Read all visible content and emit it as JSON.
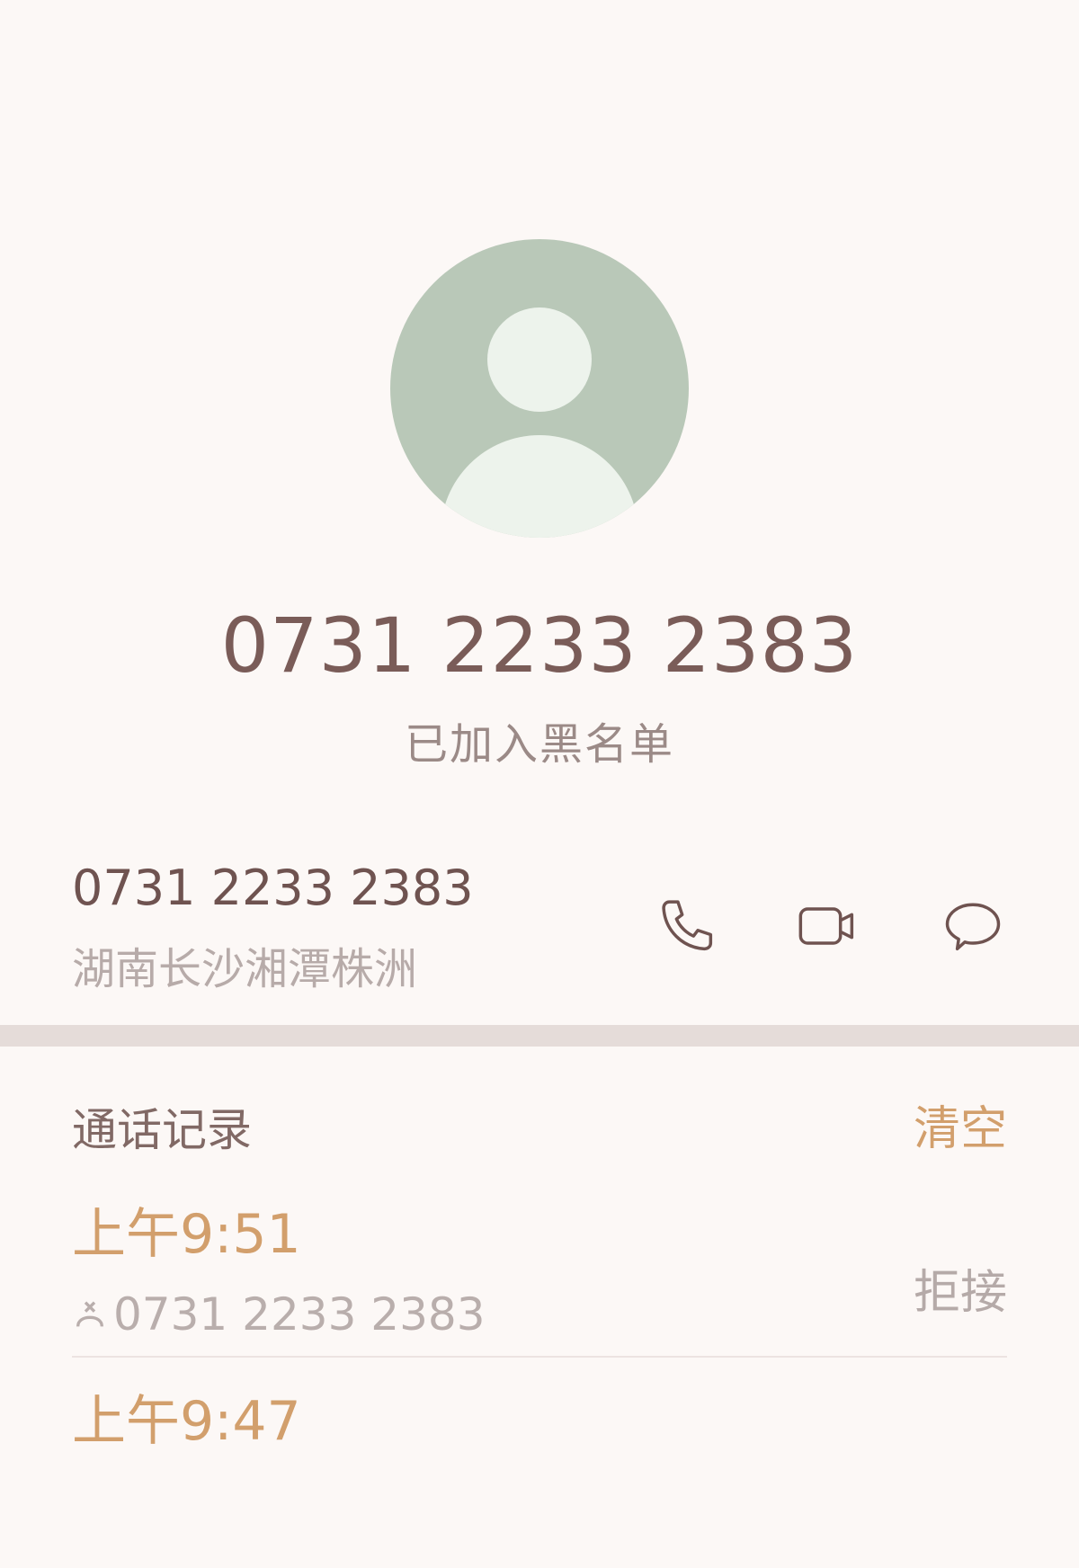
{
  "contact": {
    "number": "0731 2233 2383",
    "status": "已加入黑名单",
    "location": "湖南长沙湘潭株洲"
  },
  "actions": {
    "call_icon": "phone-icon",
    "video_icon": "video-camera-icon",
    "message_icon": "message-bubble-icon"
  },
  "call_log": {
    "title": "通话记录",
    "clear_label": "清空",
    "entries": [
      {
        "time": "上午9:51",
        "number": "0731 2233 2383",
        "result": "拒接",
        "icon": "blocked-call-icon"
      },
      {
        "time": "上午9:47",
        "number": "",
        "result": "",
        "icon": ""
      }
    ]
  },
  "colors": {
    "accent": "#d29f6c",
    "primary_text": "#7a5c58",
    "avatar_bg": "#b9c8b8",
    "background": "#fcf8f6"
  }
}
